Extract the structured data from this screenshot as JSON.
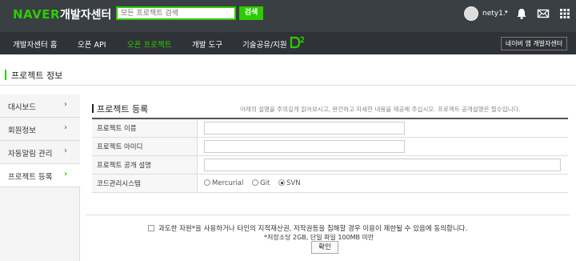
{
  "header": {
    "logo": "NAVER",
    "site_name": "개발자센터",
    "search_placeholder": "모든 프로젝트 검색",
    "search_button": "검색",
    "user_name": "nety1.",
    "user_caret": "▾"
  },
  "nav": {
    "items": [
      "개발자센터 홈",
      "오픈 API",
      "오픈 프로젝트",
      "개발 도구",
      "기술공유/지원"
    ],
    "active_index": 2,
    "app_button": "네이버 앱 개발자센터"
  },
  "page": {
    "title": "프로젝트 정보"
  },
  "sidebar": {
    "items": [
      {
        "label": "대시보드",
        "arrow": "›"
      },
      {
        "label": "회원정보",
        "arrow": "›"
      },
      {
        "label": "자동알림 관리",
        "arrow": "›"
      },
      {
        "label": "프로젝트 등록",
        "arrow": "›"
      }
    ],
    "active_index": 3
  },
  "form": {
    "title": "프로젝트 등록",
    "description": "아래의 설명을 주의깊게 읽어보시고, 완전하고 자세한 내용을 제공해 주십시오. 프로젝트 공개설명은 필수입니다.",
    "fields": [
      {
        "label": "프로젝트 이름",
        "value": ""
      },
      {
        "label": "프로젝트 아이디",
        "value": ""
      },
      {
        "label": "프로젝트 공개 설명",
        "value": ""
      },
      {
        "label": "코드관리시스템"
      }
    ],
    "scm_options": [
      "Mercurial",
      "Git",
      "SVN"
    ],
    "scm_selected": "SVN"
  },
  "footer": {
    "agree_text": "과도한 자원*을 사용하거나 타인의 지적재산권, 저작권등을 침해할 경우 이용이 제한될 수 있음에 동의합니다.",
    "quota_text": "*저장소당 2GB, 단일 파일 100MB 미만",
    "confirm_button": "확인"
  },
  "colors": {
    "brand": "#2ecb00",
    "header_bg": "#3a3f44",
    "nav_bg": "#2f3337"
  }
}
